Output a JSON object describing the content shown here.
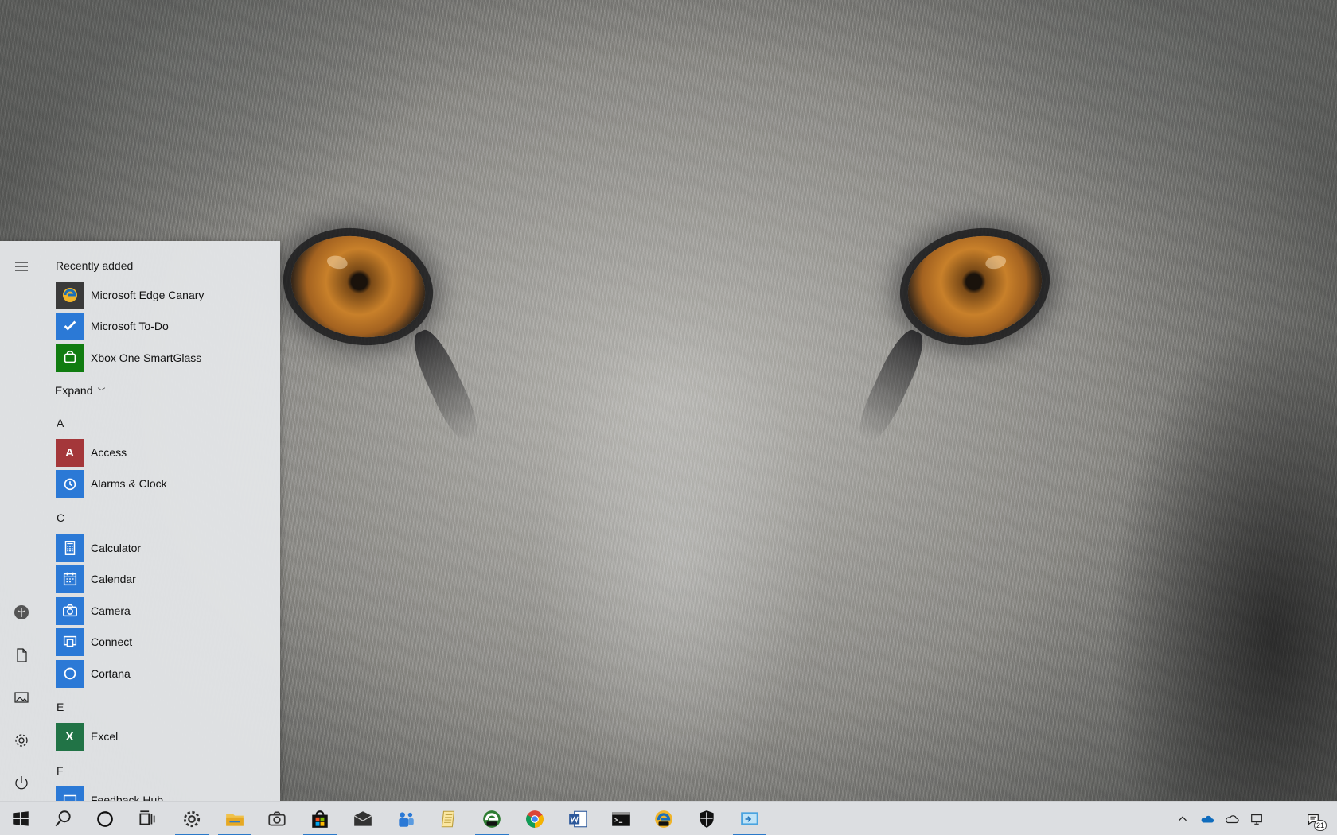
{
  "start_menu": {
    "recently_added_label": "Recently added",
    "expand_label": "Expand",
    "recent": [
      {
        "label": "Microsoft Edge Canary",
        "icon": "edge-canary-icon",
        "color": "#3a3a3a"
      },
      {
        "label": "Microsoft To-Do",
        "icon": "todo-icon",
        "color": "#2b79d6"
      },
      {
        "label": "Xbox One SmartGlass",
        "icon": "xbox-icon",
        "color": "#107c10"
      }
    ],
    "groups": [
      {
        "letter": "A",
        "apps": [
          {
            "label": "Access",
            "icon": "access-icon",
            "color": "#a4373a",
            "glyph": "A"
          },
          {
            "label": "Alarms & Clock",
            "icon": "alarm-clock-icon",
            "color": "#2b79d6",
            "glyph": "⏰"
          }
        ]
      },
      {
        "letter": "C",
        "apps": [
          {
            "label": "Calculator",
            "icon": "calculator-icon",
            "color": "#2b79d6",
            "glyph": "▦"
          },
          {
            "label": "Calendar",
            "icon": "calendar-icon",
            "color": "#2b79d6",
            "glyph": "▤"
          },
          {
            "label": "Camera",
            "icon": "camera-icon",
            "color": "#2b79d6",
            "glyph": "◉"
          },
          {
            "label": "Connect",
            "icon": "connect-icon",
            "color": "#2b79d6",
            "glyph": "⧉"
          },
          {
            "label": "Cortana",
            "icon": "cortana-icon",
            "color": "#2b79d6",
            "glyph": "○"
          }
        ]
      },
      {
        "letter": "E",
        "apps": [
          {
            "label": "Excel",
            "icon": "excel-icon",
            "color": "#217346",
            "glyph": "X"
          }
        ]
      },
      {
        "letter": "F",
        "apps": [
          {
            "label": "Feedback Hub",
            "icon": "feedback-hub-icon",
            "color": "#2b79d6",
            "glyph": "☺"
          }
        ]
      }
    ],
    "rail": [
      "hamburger-menu-icon",
      "user-avatar",
      "documents-icon",
      "pictures-icon",
      "settings-gear-icon",
      "power-icon"
    ]
  },
  "taskbar": {
    "pinned": [
      "start",
      "search",
      "cortana",
      "task-view",
      "settings",
      "file-explorer",
      "camera",
      "store",
      "mail",
      "teams",
      "notepad",
      "edge-dev",
      "chrome",
      "word",
      "terminal",
      "edge-canary",
      "security",
      "remote-desktop"
    ],
    "notification_count": "21",
    "accent": "#2b79c9"
  }
}
